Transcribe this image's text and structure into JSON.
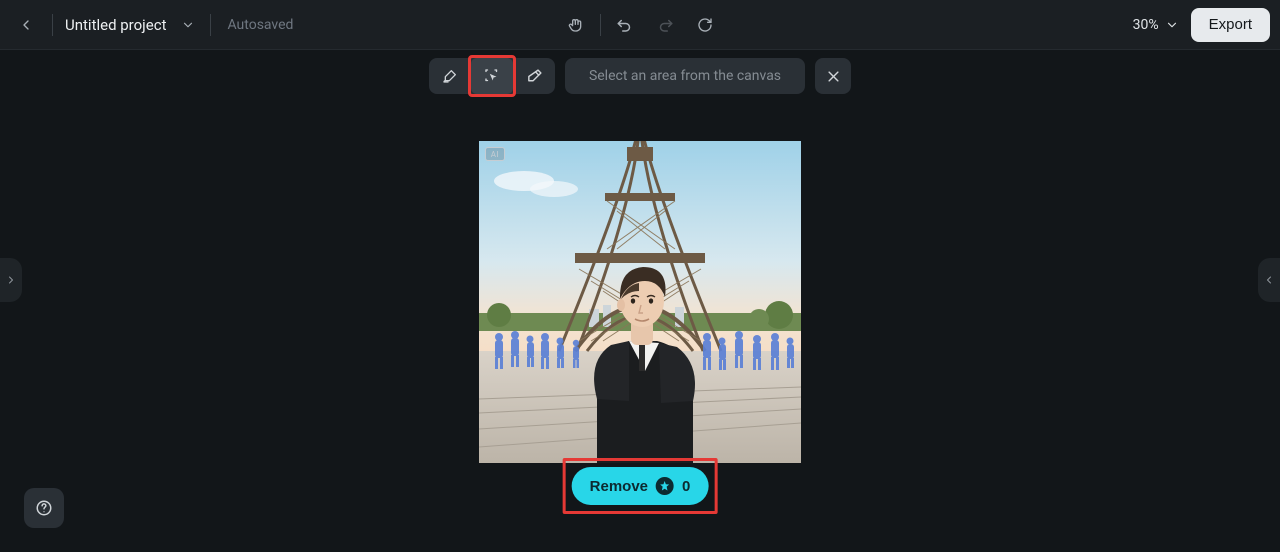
{
  "header": {
    "project_title": "Untitled project",
    "autosaved_label": "Autosaved",
    "zoom_level": "30%",
    "export_label": "Export"
  },
  "toolstrip": {
    "prompt_placeholder": "Select an area from the canvas",
    "ai_badge": "AI"
  },
  "remove": {
    "label": "Remove",
    "credits": "0"
  }
}
